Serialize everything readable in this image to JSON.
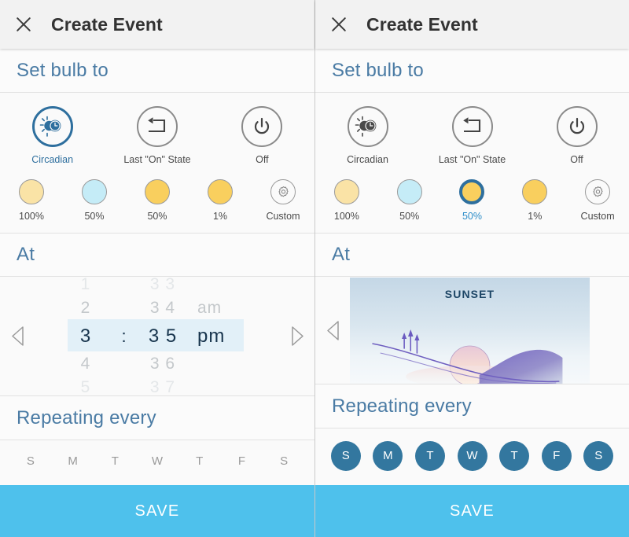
{
  "panels": [
    {
      "id": "left",
      "appbar": {
        "close_icon": "close-icon",
        "title": "Create Event"
      },
      "bulb_section": {
        "header": "Set bulb to"
      },
      "modes": [
        {
          "icon": "circadian-icon",
          "label": "Circadian",
          "selected": true
        },
        {
          "icon": "last-on-state-icon",
          "label": "Last \"On\" State",
          "selected": false
        },
        {
          "icon": "power-off-icon",
          "label": "Off",
          "selected": false
        }
      ],
      "swatches": [
        {
          "label": "100%",
          "color": "#fae3a6",
          "selected": false
        },
        {
          "label": "50%",
          "color": "#c5ecf7",
          "selected": false
        },
        {
          "label": "50%",
          "color": "#f9cf5e",
          "selected": false
        },
        {
          "label": "1%",
          "color": "#f9cf5e",
          "selected": false
        },
        {
          "label": "Custom",
          "icon": "gear-icon",
          "selected": false
        }
      ],
      "at_section": {
        "header": "At",
        "mode": "time-picker"
      },
      "time_picker": {
        "prev_icon": "chevron-left-icon",
        "next_icon": "chevron-right-icon",
        "hours": [
          "1",
          "2",
          "3",
          "4",
          "5"
        ],
        "minutes": [
          "3 3",
          "3 4",
          "3 5",
          "3 6",
          "3 7"
        ],
        "meridiem": [
          "",
          "am",
          "pm",
          "",
          ""
        ],
        "separator": ":",
        "selected_hour": "3",
        "selected_minute": "3 5",
        "selected_meridiem": "pm"
      },
      "repeat_section": {
        "header": "Repeating every"
      },
      "days": [
        {
          "label": "S",
          "on": false
        },
        {
          "label": "M",
          "on": false
        },
        {
          "label": "T",
          "on": false
        },
        {
          "label": "W",
          "on": false
        },
        {
          "label": "T",
          "on": false
        },
        {
          "label": "F",
          "on": false
        },
        {
          "label": "S",
          "on": false
        }
      ],
      "save": {
        "label": "SAVE",
        "color": "#4ec1ec"
      }
    },
    {
      "id": "right",
      "appbar": {
        "close_icon": "close-icon",
        "title": "Create Event"
      },
      "bulb_section": {
        "header": "Set bulb to"
      },
      "modes": [
        {
          "icon": "circadian-icon",
          "label": "Circadian",
          "selected": false
        },
        {
          "icon": "last-on-state-icon",
          "label": "Last \"On\" State",
          "selected": false
        },
        {
          "icon": "power-off-icon",
          "label": "Off",
          "selected": false
        }
      ],
      "swatches": [
        {
          "label": "100%",
          "color": "#fae3a6",
          "selected": false
        },
        {
          "label": "50%",
          "color": "#c5ecf7",
          "selected": false
        },
        {
          "label": "50%",
          "color": "#f9cf5e",
          "selected": true
        },
        {
          "label": "1%",
          "color": "#f9cf5e",
          "selected": false
        },
        {
          "label": "Custom",
          "icon": "gear-icon",
          "selected": false
        }
      ],
      "at_section": {
        "header": "At",
        "mode": "sunset-card"
      },
      "sunset": {
        "prev_icon": "chevron-left-icon",
        "title": "SUNSET",
        "illustration": "sunset-landscape-illustration"
      },
      "repeat_section": {
        "header": "Repeating every"
      },
      "days": [
        {
          "label": "S",
          "on": true
        },
        {
          "label": "M",
          "on": true
        },
        {
          "label": "T",
          "on": true
        },
        {
          "label": "W",
          "on": true
        },
        {
          "label": "T",
          "on": true
        },
        {
          "label": "F",
          "on": true
        },
        {
          "label": "S",
          "on": true
        }
      ],
      "save": {
        "label": "SAVE",
        "color": "#4ec1ec"
      }
    }
  ],
  "theme": {
    "accent_blue": "#2e6f9e",
    "header_blue": "#4a7ba4",
    "save_blue": "#4ec1ec",
    "day_on_blue": "#33779f",
    "picker_highlight": "#e2f0f8",
    "picker_selected_text": "#17344d"
  }
}
